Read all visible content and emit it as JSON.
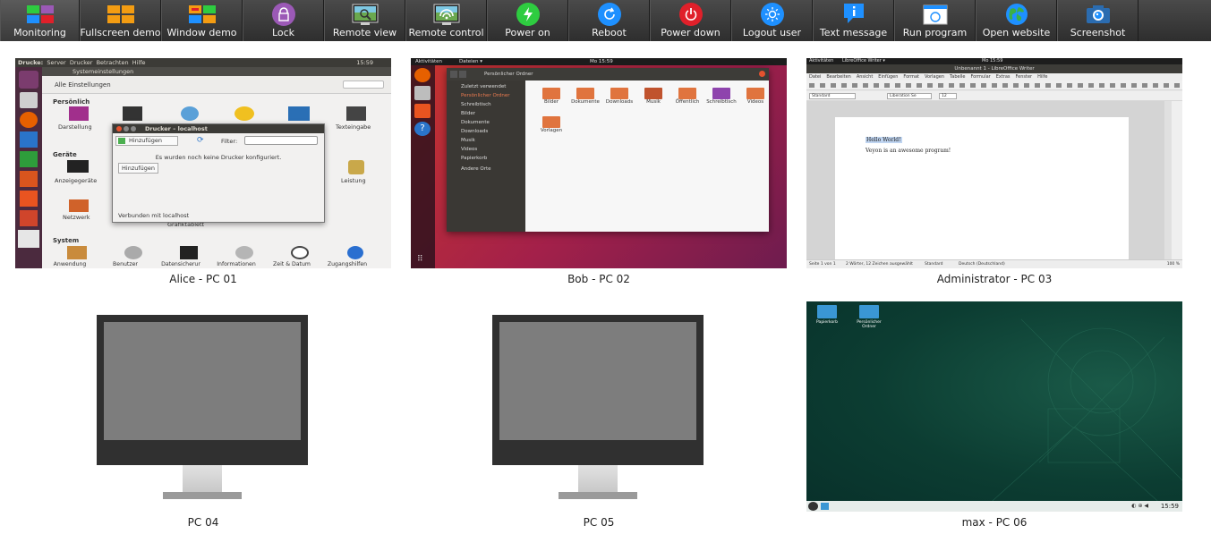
{
  "toolbar": {
    "buttons": [
      {
        "label": "Monitoring",
        "icon": "monitoring-icon"
      },
      {
        "label": "Fullscreen demo",
        "icon": "fullscreen-demo-icon"
      },
      {
        "label": "Window demo",
        "icon": "window-demo-icon"
      },
      {
        "label": "Lock",
        "icon": "lock-icon"
      },
      {
        "label": "Remote view",
        "icon": "remote-view-icon"
      },
      {
        "label": "Remote control",
        "icon": "remote-control-icon"
      },
      {
        "label": "Power on",
        "icon": "power-on-icon"
      },
      {
        "label": "Reboot",
        "icon": "reboot-icon"
      },
      {
        "label": "Power down",
        "icon": "power-down-icon"
      },
      {
        "label": "Logout user",
        "icon": "logout-user-icon"
      },
      {
        "label": "Text message",
        "icon": "text-message-icon"
      },
      {
        "label": "Run program",
        "icon": "run-program-icon"
      },
      {
        "label": "Open website",
        "icon": "open-website-icon"
      },
      {
        "label": "Screenshot",
        "icon": "screenshot-icon"
      }
    ]
  },
  "computers": [
    {
      "label": "Alice - PC 01"
    },
    {
      "label": "Bob - PC 02"
    },
    {
      "label": "Administrator - PC 03"
    },
    {
      "label": "PC 04"
    },
    {
      "label": "PC 05"
    },
    {
      "label": "max - PC 06"
    }
  ],
  "alice_screen": {
    "menubar": [
      "Drucke:",
      "Server",
      "Drucker",
      "Betrachten",
      "Hilfe"
    ],
    "clock": "15:59",
    "window_title": "Systemeinstellungen",
    "all_settings": "Alle Einstellungen",
    "section_personal": "Persönlich",
    "item_darstellung": "Darstellung",
    "item_texteingabe": "Texteingabe",
    "section_devices": "Geräte",
    "item_anzeigegeraete": "Anzeigegeräte",
    "item_leistung": "Leistung",
    "item_netzwerk": "Netzwerk",
    "item_grafiktablett": "Grafiktablett",
    "section_system": "System",
    "system_items": [
      "Anwendung",
      "Benutzer",
      "Datensicherur",
      "Informationen",
      "Zeit & Datum",
      "Zugangshilfen"
    ],
    "dialog_title": "Drucker – localhost",
    "dialog_add": "Hinzufügen",
    "dialog_filter": "Filter:",
    "dialog_message": "Es wurden noch keine Drucker konfiguriert.",
    "dialog_add_button": "Hinzufügen",
    "dialog_status": "Verbunden mit localhost"
  },
  "bob_screen": {
    "activities": "Aktivitäten",
    "app_menu": "Dateien ▾",
    "clock": "Mo 15:59",
    "path": "Persönlicher Ordner",
    "sidebar": [
      "Zuletzt verwendet",
      "Persönlicher Ordner",
      "Schreibtisch",
      "Bilder",
      "Dokumente",
      "Downloads",
      "Musik",
      "Videos",
      "Papierkorb",
      "Andere Orte"
    ],
    "folders": [
      "Bilder",
      "Dokumente",
      "Downloads",
      "Musik",
      "Öffentlich",
      "Schreibtisch",
      "Videos",
      "Vorlagen"
    ]
  },
  "admin_screen": {
    "activities": "Aktivitäten",
    "app_menu": "LibreOffice Writer ▾",
    "clock": "Mo 15:59",
    "window_title": "Unbenannt 1 - LibreOffice Writer",
    "menu": [
      "Datei",
      "Bearbeiten",
      "Ansicht",
      "Einfügen",
      "Format",
      "Vorlagen",
      "Tabelle",
      "Formular",
      "Extras",
      "Fenster",
      "Hilfe"
    ],
    "style_box": "Standard",
    "font_box": "Liberation Se",
    "size_box": "12",
    "doc_line1": "Hello World!",
    "doc_line2": "Veyon is an awesome program!",
    "status_page": "Seite 1 von 1",
    "status_words": "2 Wörter, 12 Zeichen ausgewählt",
    "status_style": "Standard",
    "status_lang": "Deutsch (Deutschland)",
    "status_zoom": "100 %"
  },
  "max_screen": {
    "desktop_icons": [
      "Papierkorb",
      "Persönlicher Ordner"
    ],
    "clock": "15:59"
  },
  "colors": {
    "toolbar_bg": "#3a3a3a",
    "lock": "#9b59b6",
    "power_on": "#2ecc40",
    "reboot": "#1e90ff",
    "power_down": "#e0202a",
    "logout": "#1e90ff"
  }
}
